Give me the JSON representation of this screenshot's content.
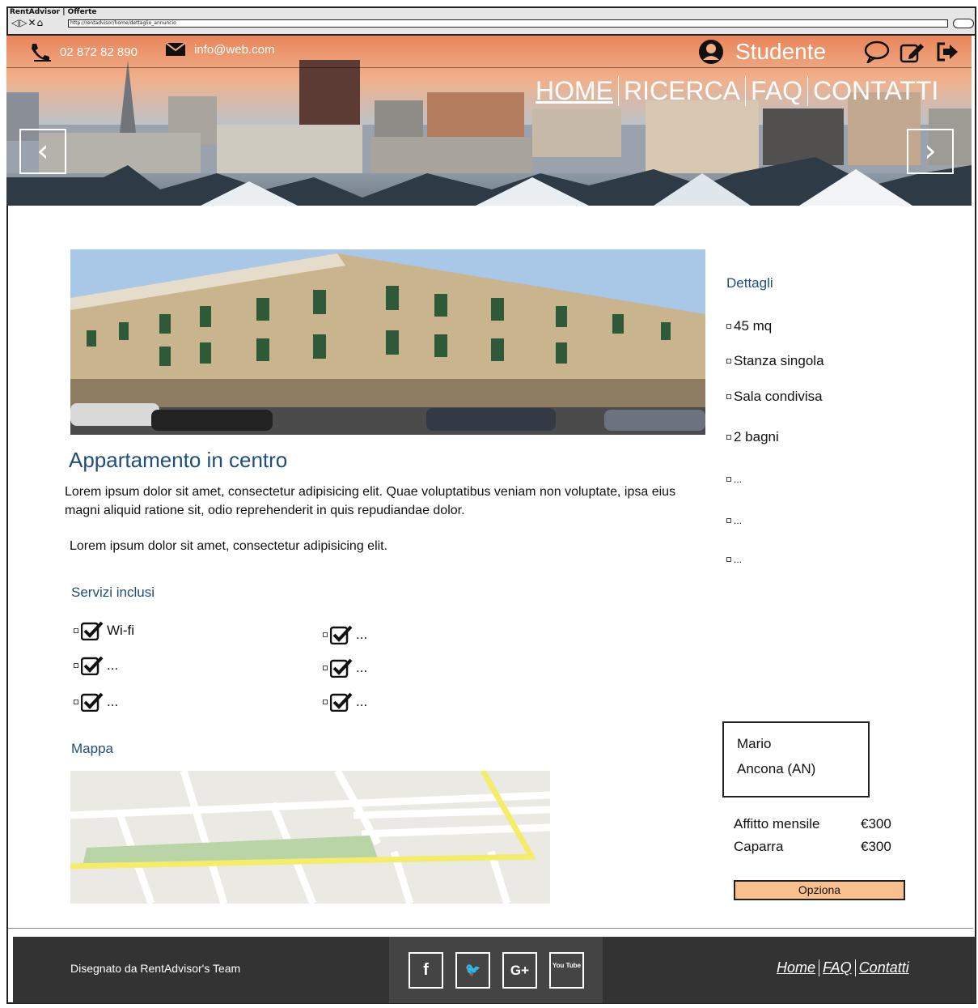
{
  "browser": {
    "title": "RentAdvisor | Offerte",
    "nav_glyphs": "◁▷✕⌂",
    "url": "http://rentadvisor/home/dettaglio_annuncio"
  },
  "header": {
    "phone": "02 872 82 890",
    "email": "info@web.com",
    "user": "Studente",
    "icons": [
      "phone-icon",
      "mail-icon",
      "user-icon",
      "chat-icon",
      "edit-icon",
      "logout-icon"
    ],
    "nav": [
      {
        "label": "HOME",
        "selected": true
      },
      {
        "label": "RICERCA",
        "selected": false
      },
      {
        "label": "FAQ",
        "selected": false
      },
      {
        "label": "CONTATTI",
        "selected": false
      }
    ],
    "prev": "‹",
    "next": "›"
  },
  "listing": {
    "title": "Appartamento in centro",
    "description": "Lorem ipsum dolor sit amet, consectetur adipisicing elit. Quae voluptatibus veniam non voluptate, ipsa eius magni aliquid ratione sit, odio reprehenderit in quis repudiandae dolor.",
    "description2": "Lorem ipsum dolor sit amet, consectetur adipisicing elit."
  },
  "services": {
    "heading": "Servizi inclusi",
    "items": [
      "Wi-fi",
      "...",
      "...",
      "...",
      "...",
      "..."
    ]
  },
  "map": {
    "heading": "Mappa"
  },
  "details": {
    "heading": "Dettagli",
    "items": [
      "45 mq",
      "Stanza singola",
      "Sala condivisa",
      "2 bagni",
      "...",
      "...",
      "..."
    ]
  },
  "owner": {
    "name": "Mario",
    "city": "Ancona (AN)"
  },
  "pricing": {
    "rent_label": "Affitto mensile",
    "rent_value": "€300",
    "deposit_label": "Caparra",
    "deposit_value": "€300",
    "button": "Opziona"
  },
  "footer": {
    "credit": "Disegnato da RentAdvisor's Team",
    "social": [
      "f",
      "🐦",
      "G+",
      "You Tube"
    ],
    "links": [
      "Home",
      "FAQ",
      "Contatti"
    ]
  },
  "colors": {
    "heading": "#1f4e79",
    "button": "#f9c08f",
    "footer": "#333333"
  }
}
